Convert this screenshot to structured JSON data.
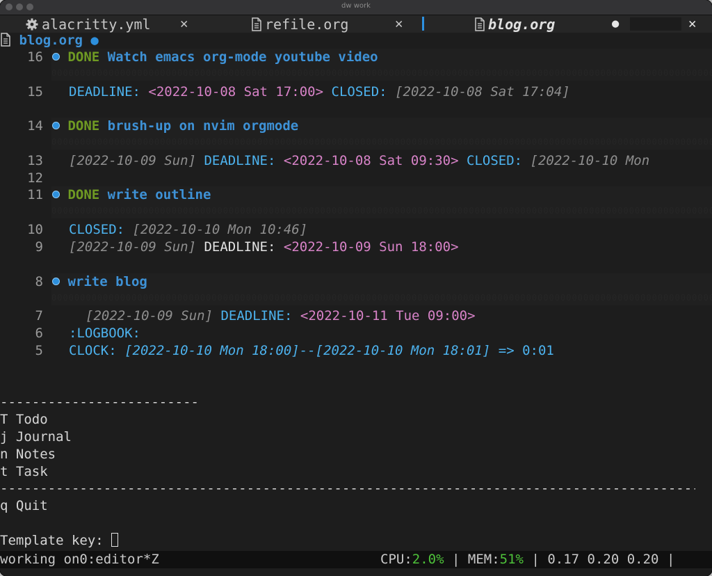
{
  "window": {
    "title": "dw work"
  },
  "tabs": [
    {
      "label": "alacritty.yml",
      "close": "✕",
      "icon": "gear-icon"
    },
    {
      "label": "refile.org",
      "close": "✕",
      "icon": "file-icon"
    },
    {
      "label": "blog.org",
      "close": "✕",
      "icon": "file-icon",
      "modified": "●"
    }
  ],
  "buffer": {
    "name": "blog.org",
    "modified": "●"
  },
  "editor": {
    "h16": {
      "ln": "16",
      "kw": "DONE",
      "title": "Watch emacs org-mode youtube video"
    },
    "l15": {
      "ln": "15",
      "deadline_kw": "DEADLINE:",
      "deadline": "<2022-10-08 Sat 17:00>",
      "closed_kw": "CLOSED:",
      "closed": "[2022-10-08 Sat 17:04]"
    },
    "h14": {
      "ln": "14",
      "kw": "DONE",
      "title": "brush-up on nvim orgmode"
    },
    "l13": {
      "ln": "13",
      "date": "[2022-10-09 Sun]",
      "deadline_kw": "DEADLINE:",
      "deadline": "<2022-10-08 Sat 09:30>",
      "closed_kw": "CLOSED:",
      "closed": "[2022-10-10 Mon"
    },
    "l12": {
      "ln": "12"
    },
    "h11": {
      "ln": "11",
      "kw": "DONE",
      "title": "write outline"
    },
    "l10": {
      "ln": "10",
      "closed_kw": "CLOSED:",
      "closed": "[2022-10-10 Mon 10:46]"
    },
    "l9": {
      "ln": "9",
      "date": "[2022-10-09 Sun]",
      "deadline_kw": "DEADLINE:",
      "deadline": "<2022-10-09 Sun 18:00>"
    },
    "h8": {
      "ln": "8",
      "title": "write blog"
    },
    "l7": {
      "ln": "7",
      "date": "[2022-10-09 Sun]",
      "deadline_kw": "DEADLINE:",
      "deadline": "<2022-10-11 Tue 09:00>"
    },
    "l6": {
      "ln": "6",
      "text": ":LOGBOOK:"
    },
    "l5": {
      "ln": "5",
      "clock_kw": "CLOCK:",
      "range": "[2022-10-10 Mon 18:00]--[2022-10-10 Mon 18:01]",
      "result": "=> 0:01"
    }
  },
  "codes": {
    "pattern": "0000000000000000000000000000000000000000000000000000000000000000000000000000000000000000000000000000000000000000000000000000000000000000000000000000000000"
  },
  "capture_menu": {
    "sep_short": "-------------------------",
    "items": [
      {
        "key": "T",
        "label": "Todo"
      },
      {
        "key": "j",
        "label": "Journal"
      },
      {
        "key": "n",
        "label": "Notes"
      },
      {
        "key": "t",
        "label": "Task"
      }
    ],
    "sep_long": "---------------------------------------------------------------------------------------------------",
    "quit_key": "q",
    "quit_label": "Quit",
    "prompt": "Template key:"
  },
  "statusbar": {
    "left": "working on0:editor*Z",
    "cpu_label": "CPU:",
    "cpu_value": "2.0%",
    "sep": "|",
    "mem_label": "MEM:",
    "mem_value": "51%",
    "load": "0.17 0.20 0.20"
  },
  "colors": {
    "background": "#1d1d1d",
    "accent_blue": "#2d91e1",
    "done_green": "#6f9a23",
    "keyword_cyan": "#4db3ef",
    "timestamp_pink": "#d883c8",
    "status_green": "#4ec23a"
  }
}
